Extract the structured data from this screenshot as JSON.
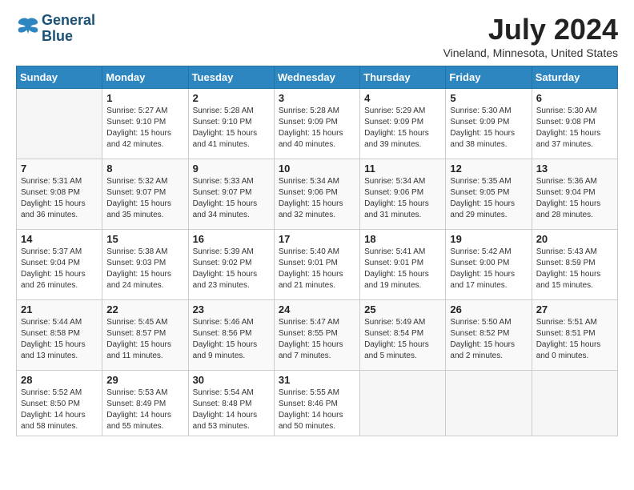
{
  "header": {
    "logo_line1": "General",
    "logo_line2": "Blue",
    "month_year": "July 2024",
    "location": "Vineland, Minnesota, United States"
  },
  "weekdays": [
    "Sunday",
    "Monday",
    "Tuesday",
    "Wednesday",
    "Thursday",
    "Friday",
    "Saturday"
  ],
  "weeks": [
    [
      {
        "day": "",
        "info": ""
      },
      {
        "day": "1",
        "info": "Sunrise: 5:27 AM\nSunset: 9:10 PM\nDaylight: 15 hours\nand 42 minutes."
      },
      {
        "day": "2",
        "info": "Sunrise: 5:28 AM\nSunset: 9:10 PM\nDaylight: 15 hours\nand 41 minutes."
      },
      {
        "day": "3",
        "info": "Sunrise: 5:28 AM\nSunset: 9:09 PM\nDaylight: 15 hours\nand 40 minutes."
      },
      {
        "day": "4",
        "info": "Sunrise: 5:29 AM\nSunset: 9:09 PM\nDaylight: 15 hours\nand 39 minutes."
      },
      {
        "day": "5",
        "info": "Sunrise: 5:30 AM\nSunset: 9:09 PM\nDaylight: 15 hours\nand 38 minutes."
      },
      {
        "day": "6",
        "info": "Sunrise: 5:30 AM\nSunset: 9:08 PM\nDaylight: 15 hours\nand 37 minutes."
      }
    ],
    [
      {
        "day": "7",
        "info": "Sunrise: 5:31 AM\nSunset: 9:08 PM\nDaylight: 15 hours\nand 36 minutes."
      },
      {
        "day": "8",
        "info": "Sunrise: 5:32 AM\nSunset: 9:07 PM\nDaylight: 15 hours\nand 35 minutes."
      },
      {
        "day": "9",
        "info": "Sunrise: 5:33 AM\nSunset: 9:07 PM\nDaylight: 15 hours\nand 34 minutes."
      },
      {
        "day": "10",
        "info": "Sunrise: 5:34 AM\nSunset: 9:06 PM\nDaylight: 15 hours\nand 32 minutes."
      },
      {
        "day": "11",
        "info": "Sunrise: 5:34 AM\nSunset: 9:06 PM\nDaylight: 15 hours\nand 31 minutes."
      },
      {
        "day": "12",
        "info": "Sunrise: 5:35 AM\nSunset: 9:05 PM\nDaylight: 15 hours\nand 29 minutes."
      },
      {
        "day": "13",
        "info": "Sunrise: 5:36 AM\nSunset: 9:04 PM\nDaylight: 15 hours\nand 28 minutes."
      }
    ],
    [
      {
        "day": "14",
        "info": "Sunrise: 5:37 AM\nSunset: 9:04 PM\nDaylight: 15 hours\nand 26 minutes."
      },
      {
        "day": "15",
        "info": "Sunrise: 5:38 AM\nSunset: 9:03 PM\nDaylight: 15 hours\nand 24 minutes."
      },
      {
        "day": "16",
        "info": "Sunrise: 5:39 AM\nSunset: 9:02 PM\nDaylight: 15 hours\nand 23 minutes."
      },
      {
        "day": "17",
        "info": "Sunrise: 5:40 AM\nSunset: 9:01 PM\nDaylight: 15 hours\nand 21 minutes."
      },
      {
        "day": "18",
        "info": "Sunrise: 5:41 AM\nSunset: 9:01 PM\nDaylight: 15 hours\nand 19 minutes."
      },
      {
        "day": "19",
        "info": "Sunrise: 5:42 AM\nSunset: 9:00 PM\nDaylight: 15 hours\nand 17 minutes."
      },
      {
        "day": "20",
        "info": "Sunrise: 5:43 AM\nSunset: 8:59 PM\nDaylight: 15 hours\nand 15 minutes."
      }
    ],
    [
      {
        "day": "21",
        "info": "Sunrise: 5:44 AM\nSunset: 8:58 PM\nDaylight: 15 hours\nand 13 minutes."
      },
      {
        "day": "22",
        "info": "Sunrise: 5:45 AM\nSunset: 8:57 PM\nDaylight: 15 hours\nand 11 minutes."
      },
      {
        "day": "23",
        "info": "Sunrise: 5:46 AM\nSunset: 8:56 PM\nDaylight: 15 hours\nand 9 minutes."
      },
      {
        "day": "24",
        "info": "Sunrise: 5:47 AM\nSunset: 8:55 PM\nDaylight: 15 hours\nand 7 minutes."
      },
      {
        "day": "25",
        "info": "Sunrise: 5:49 AM\nSunset: 8:54 PM\nDaylight: 15 hours\nand 5 minutes."
      },
      {
        "day": "26",
        "info": "Sunrise: 5:50 AM\nSunset: 8:52 PM\nDaylight: 15 hours\nand 2 minutes."
      },
      {
        "day": "27",
        "info": "Sunrise: 5:51 AM\nSunset: 8:51 PM\nDaylight: 15 hours\nand 0 minutes."
      }
    ],
    [
      {
        "day": "28",
        "info": "Sunrise: 5:52 AM\nSunset: 8:50 PM\nDaylight: 14 hours\nand 58 minutes."
      },
      {
        "day": "29",
        "info": "Sunrise: 5:53 AM\nSunset: 8:49 PM\nDaylight: 14 hours\nand 55 minutes."
      },
      {
        "day": "30",
        "info": "Sunrise: 5:54 AM\nSunset: 8:48 PM\nDaylight: 14 hours\nand 53 minutes."
      },
      {
        "day": "31",
        "info": "Sunrise: 5:55 AM\nSunset: 8:46 PM\nDaylight: 14 hours\nand 50 minutes."
      },
      {
        "day": "",
        "info": ""
      },
      {
        "day": "",
        "info": ""
      },
      {
        "day": "",
        "info": ""
      }
    ]
  ]
}
